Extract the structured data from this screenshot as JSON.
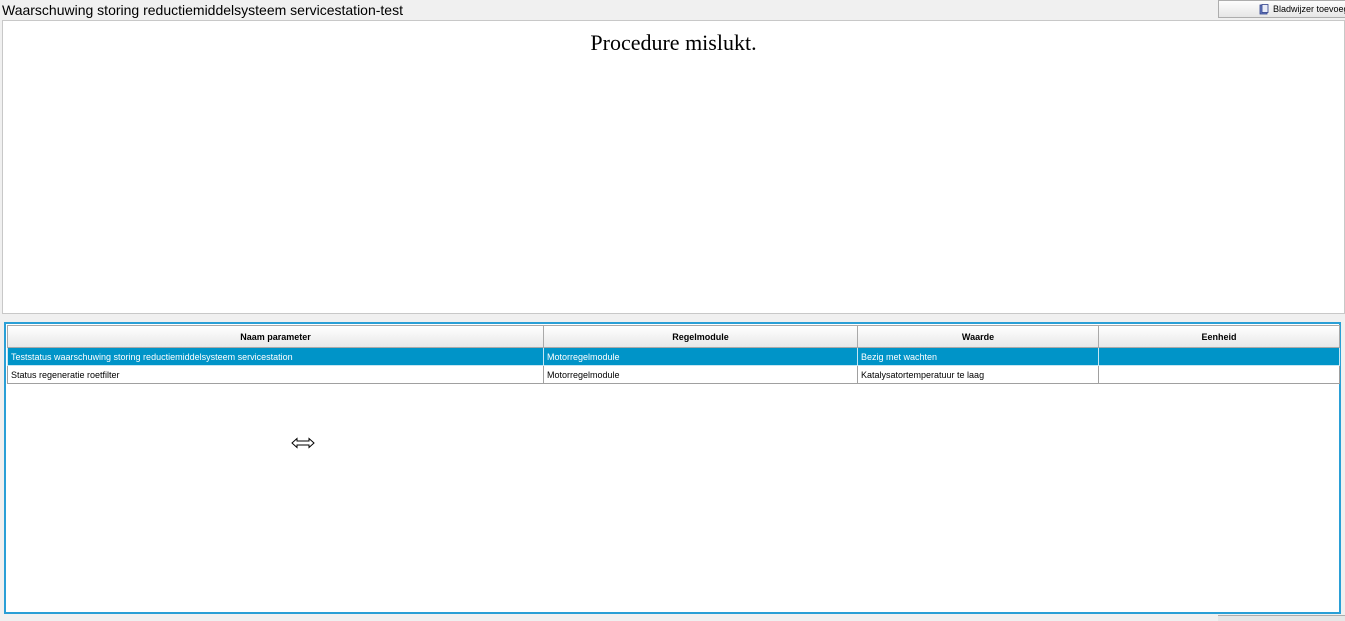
{
  "window": {
    "title": "Waarschuwing storing reductiemiddelsysteem servicestation-test"
  },
  "toolbar": {
    "bookmark_label": "Bladwijzer toevoegen",
    "bookmark_icon": "bookmark-icon"
  },
  "message": {
    "text": "Procedure mislukt."
  },
  "table": {
    "columns": [
      "Naam parameter",
      "Regelmodule",
      "Waarde",
      "Eenheid"
    ],
    "rows": [
      {
        "name": "Teststatus waarschuwing storing reductiemiddelsysteem servicestation",
        "module": "Motorregelmodule",
        "value": "Bezig met wachten",
        "unit": "",
        "selected": true
      },
      {
        "name": "Status regeneratie roetfilter",
        "module": "Motorregelmodule",
        "value": "Katalysatortemperatuur te laag",
        "unit": "",
        "selected": false
      }
    ]
  },
  "colors": {
    "selection": "#0094c8",
    "panel_border": "#2a9fd6"
  }
}
